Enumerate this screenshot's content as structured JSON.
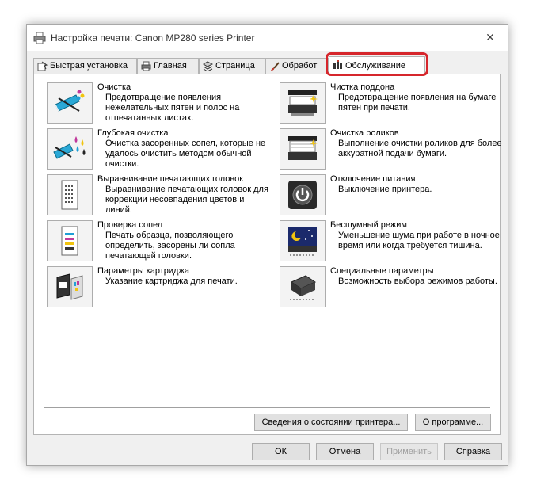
{
  "window": {
    "title": "Настройка печати: Canon MP280 series Printer",
    "close_glyph": "✕"
  },
  "tabs": [
    {
      "label": "Быстрая установка",
      "icon": "quick-setup-icon"
    },
    {
      "label": "Главная",
      "icon": "main-printer-icon"
    },
    {
      "label": "Страница",
      "icon": "page-layers-icon"
    },
    {
      "label": "Обработ",
      "icon": "effects-brush-icon"
    },
    {
      "label": "Обслуживание",
      "icon": "maintenance-tools-icon",
      "active": true
    }
  ],
  "items_left": [
    {
      "title": "Очистка",
      "desc": "Предотвращение появления нежелательных пятен и полос на отпечатанных листах.",
      "icon": "cleaning-icon"
    },
    {
      "title": "Глубокая очистка",
      "desc": "Очистка засоренных сопел, которые не удалось очистить методом обычной очистки.",
      "icon": "deep-cleaning-icon"
    },
    {
      "title": "Выравнивание печатающих головок",
      "desc": "Выравнивание печатающих головок для коррекции несовпадения цветов и линий.",
      "icon": "head-alignment-icon"
    },
    {
      "title": "Проверка сопел",
      "desc": "Печать образца, позволяющего определить, засорены ли сопла печатающей головки.",
      "icon": "nozzle-check-icon"
    },
    {
      "title": "Параметры картриджа",
      "desc": "Указание картриджа для печати.",
      "icon": "cartridge-settings-icon"
    }
  ],
  "items_right": [
    {
      "title": "Чистка поддона",
      "desc": "Предотвращение появления на бумаге пятен при печати.",
      "icon": "bottom-plate-cleaning-icon"
    },
    {
      "title": "Очистка роликов",
      "desc": "Выполнение очистки роликов для более аккуратной подачи бумаги.",
      "icon": "roller-cleaning-icon"
    },
    {
      "title": "Отключение питания",
      "desc": "Выключение принтера.",
      "icon": "power-off-icon"
    },
    {
      "title": "Бесшумный режим",
      "desc": "Уменьшение шума при работе в ночное время или когда требуется тишина.",
      "icon": "quiet-mode-icon"
    },
    {
      "title": "Специальные параметры",
      "desc": "Возможность выбора режимов работы.",
      "icon": "custom-settings-icon"
    }
  ],
  "panel_buttons": {
    "status": "Сведения о состоянии принтера...",
    "about": "О программе..."
  },
  "footer_buttons": {
    "ok": "ОК",
    "cancel": "Отмена",
    "apply": "Применить",
    "help": "Справка"
  },
  "colors": {
    "highlight": "#d6262c"
  }
}
